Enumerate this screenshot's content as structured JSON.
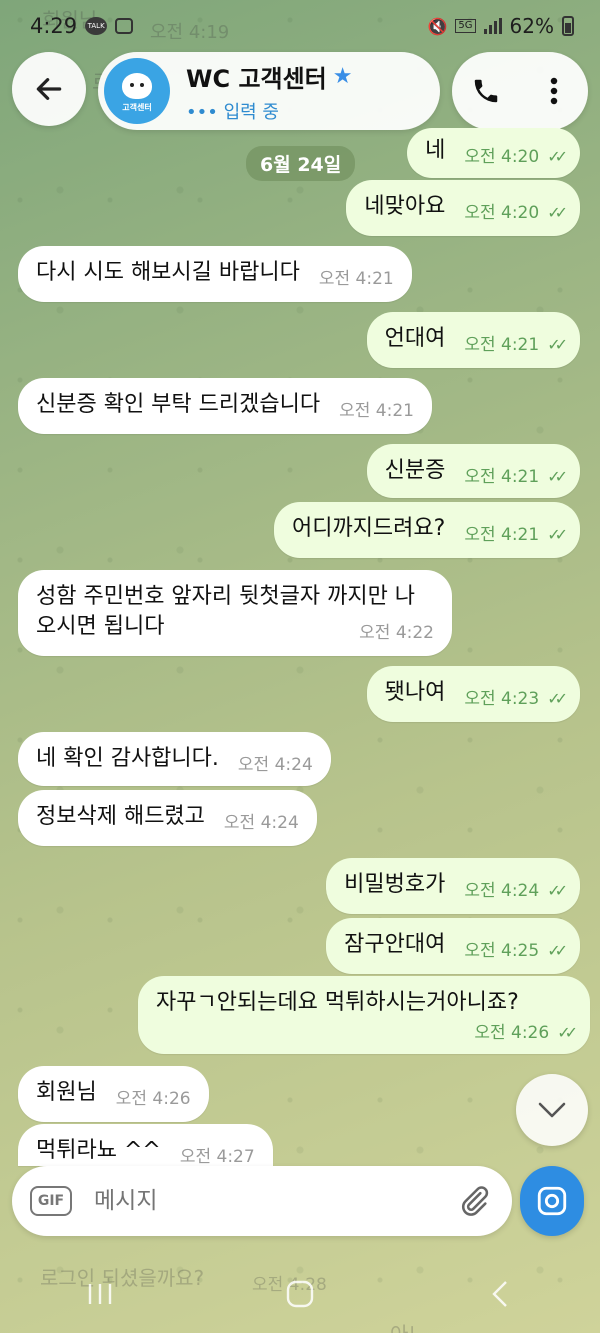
{
  "status_bar": {
    "time": "4:29",
    "talk_icon_label": "TALK",
    "battery": "62%",
    "network": "5G"
  },
  "header": {
    "title": "WC 고객센터",
    "status": "••• 입력 중",
    "avatar_label": "고객센터"
  },
  "ghost_top": {
    "first": "회원님",
    "second_prefix": "로",
    "time": "오전 4:19"
  },
  "date_badge": "6월 24일",
  "messages": [
    {
      "dir": "out",
      "text": "네",
      "time": "오전 4:20"
    },
    {
      "dir": "out",
      "text": "네맞아요",
      "time": "오전 4:20"
    },
    {
      "dir": "in",
      "text": "다시 시도 해보시길 바랍니다",
      "time": "오전 4:21"
    },
    {
      "dir": "out",
      "text": "언대여",
      "time": "오전 4:21"
    },
    {
      "dir": "in",
      "text": "신분증 확인 부탁 드리겠습니다",
      "time": "오전 4:21"
    },
    {
      "dir": "out",
      "text": "신분증",
      "time": "오전 4:21"
    },
    {
      "dir": "out",
      "text": "어디까지드려요?",
      "time": "오전 4:21"
    },
    {
      "dir": "in",
      "text": "성함 주민번호 앞자리 뒷첫글자 까지만 나오시면 됩니다",
      "time": "오전 4:22"
    },
    {
      "dir": "out",
      "text": "됏나여",
      "time": "오전 4:23"
    },
    {
      "dir": "in",
      "text": "네 확인 감사합니다.",
      "time": "오전 4:24"
    },
    {
      "dir": "in",
      "text": "정보삭제 해드렸고",
      "time": "오전 4:24"
    },
    {
      "dir": "out",
      "text": "비밀벙호가",
      "time": "오전 4:24"
    },
    {
      "dir": "out",
      "text": "잠구안대여",
      "time": "오전 4:25"
    },
    {
      "dir": "out",
      "text": "자꾸ㄱ안되는데요 먹튀하시는거아니죠?",
      "time": "오전 4:26"
    },
    {
      "dir": "in",
      "text": "회원님",
      "time": "오전 4:26"
    },
    {
      "dir": "in",
      "text": "먹튀라뇨 ^^",
      "time": "오전 4:27"
    }
  ],
  "ghost_bottom": {
    "text": "로그인 되셨을까요?",
    "time": "오전 4:28",
    "reply": "아뇨"
  },
  "input": {
    "gif_label": "GIF",
    "placeholder": "메시지"
  }
}
